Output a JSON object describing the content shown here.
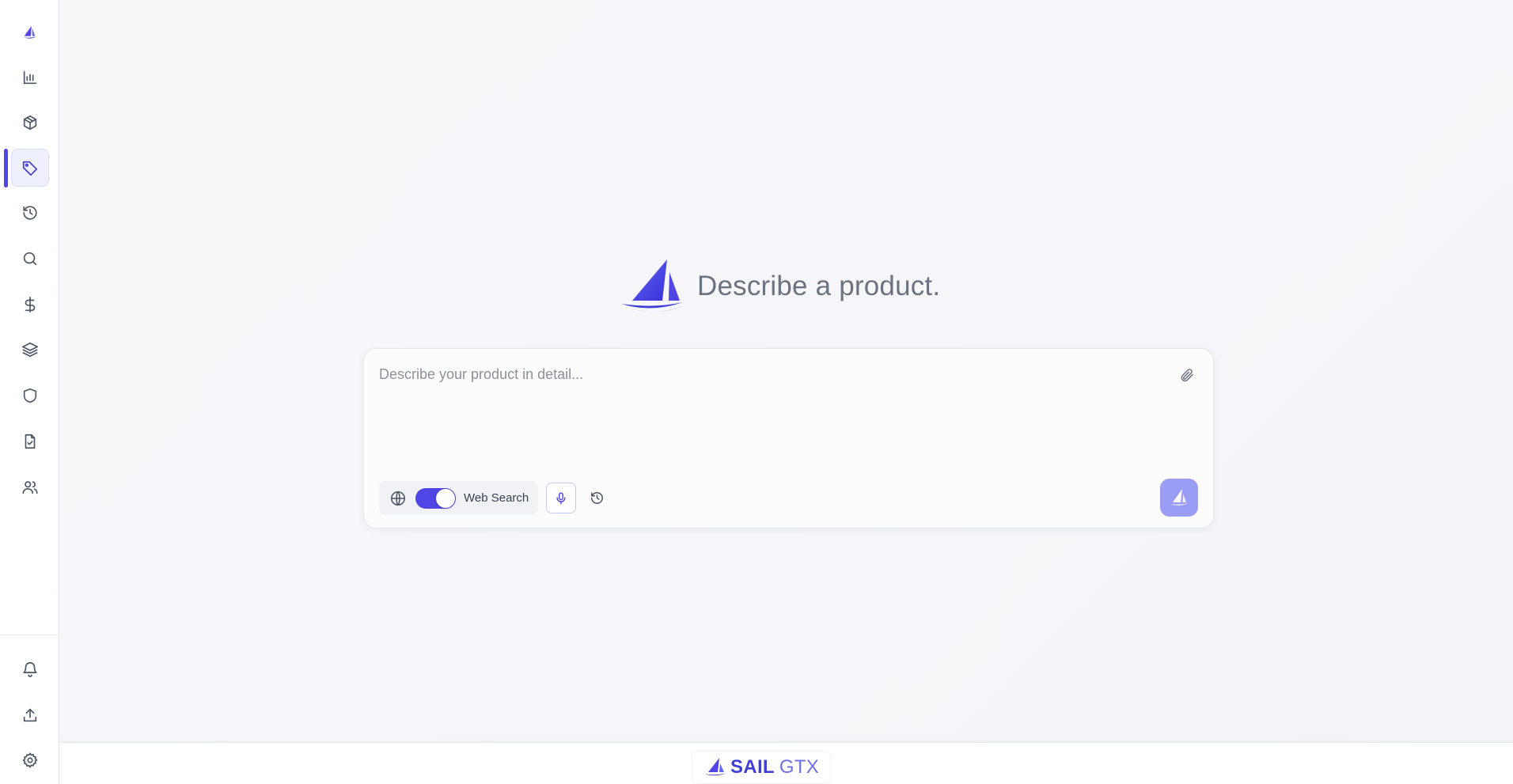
{
  "colors": {
    "accent": "#4f46e5",
    "send_button": "#9b9cf3",
    "brand": "#3f3fd6"
  },
  "sidebar": {
    "top_items": [
      {
        "icon": "sail-logo-icon",
        "active": false
      },
      {
        "icon": "bar-chart-icon",
        "active": false
      },
      {
        "icon": "box-icon",
        "active": false
      },
      {
        "icon": "tag-icon",
        "active": true
      },
      {
        "icon": "history-icon",
        "active": false
      },
      {
        "icon": "search-icon",
        "active": false
      },
      {
        "icon": "dollar-icon",
        "active": false
      },
      {
        "icon": "layers-icon",
        "active": false
      },
      {
        "icon": "shield-icon",
        "active": false
      },
      {
        "icon": "file-check-icon",
        "active": false
      },
      {
        "icon": "users-icon",
        "active": false
      }
    ],
    "bottom_items": [
      {
        "icon": "bell-icon"
      },
      {
        "icon": "upload-icon"
      },
      {
        "icon": "gear-icon"
      }
    ]
  },
  "hero": {
    "title": "Describe a product."
  },
  "composer": {
    "placeholder": "Describe your product in detail...",
    "value": "",
    "web_search_label": "Web Search",
    "web_search_enabled": true
  },
  "footer": {
    "brand_bold": "SAIL",
    "brand_light": "GTX"
  }
}
